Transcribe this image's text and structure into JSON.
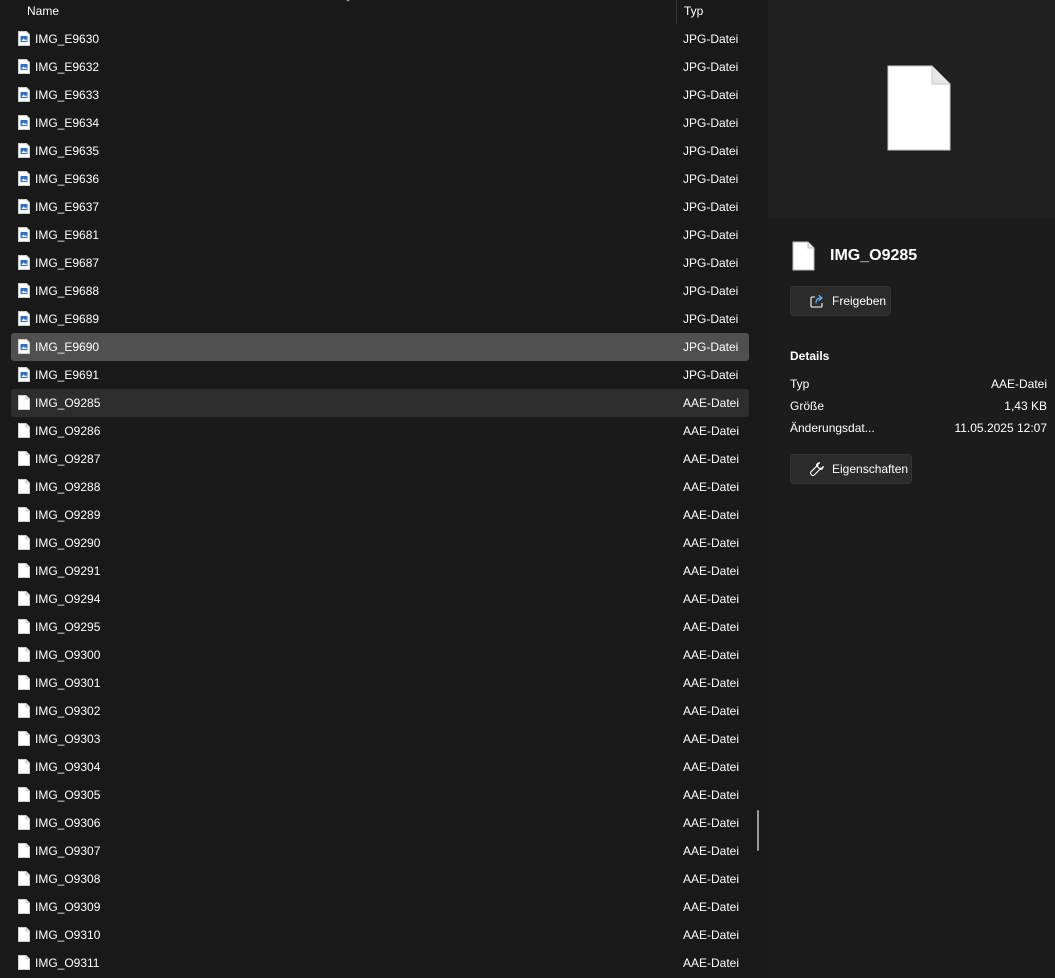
{
  "list": {
    "columns": {
      "name": "Name",
      "type": "Typ"
    },
    "rows": [
      {
        "name": "IMG_E9630",
        "type": "JPG-Datei",
        "icon": "jpg-file-icon",
        "state": ""
      },
      {
        "name": "IMG_E9632",
        "type": "JPG-Datei",
        "icon": "jpg-file-icon",
        "state": ""
      },
      {
        "name": "IMG_E9633",
        "type": "JPG-Datei",
        "icon": "jpg-file-icon",
        "state": ""
      },
      {
        "name": "IMG_E9634",
        "type": "JPG-Datei",
        "icon": "jpg-file-icon",
        "state": ""
      },
      {
        "name": "IMG_E9635",
        "type": "JPG-Datei",
        "icon": "jpg-file-icon",
        "state": ""
      },
      {
        "name": "IMG_E9636",
        "type": "JPG-Datei",
        "icon": "jpg-file-icon",
        "state": ""
      },
      {
        "name": "IMG_E9637",
        "type": "JPG-Datei",
        "icon": "jpg-file-icon",
        "state": ""
      },
      {
        "name": "IMG_E9681",
        "type": "JPG-Datei",
        "icon": "jpg-file-icon",
        "state": ""
      },
      {
        "name": "IMG_E9687",
        "type": "JPG-Datei",
        "icon": "jpg-file-icon",
        "state": ""
      },
      {
        "name": "IMG_E9688",
        "type": "JPG-Datei",
        "icon": "jpg-file-icon",
        "state": ""
      },
      {
        "name": "IMG_E9689",
        "type": "JPG-Datei",
        "icon": "jpg-file-icon",
        "state": ""
      },
      {
        "name": "IMG_E9690",
        "type": "JPG-Datei",
        "icon": "jpg-file-icon",
        "state": "selected"
      },
      {
        "name": "IMG_E9691",
        "type": "JPG-Datei",
        "icon": "jpg-file-icon",
        "state": ""
      },
      {
        "name": "IMG_O9285",
        "type": "AAE-Datei",
        "icon": "blank-file-icon",
        "state": "focused"
      },
      {
        "name": "IMG_O9286",
        "type": "AAE-Datei",
        "icon": "blank-file-icon",
        "state": ""
      },
      {
        "name": "IMG_O9287",
        "type": "AAE-Datei",
        "icon": "blank-file-icon",
        "state": ""
      },
      {
        "name": "IMG_O9288",
        "type": "AAE-Datei",
        "icon": "blank-file-icon",
        "state": ""
      },
      {
        "name": "IMG_O9289",
        "type": "AAE-Datei",
        "icon": "blank-file-icon",
        "state": ""
      },
      {
        "name": "IMG_O9290",
        "type": "AAE-Datei",
        "icon": "blank-file-icon",
        "state": ""
      },
      {
        "name": "IMG_O9291",
        "type": "AAE-Datei",
        "icon": "blank-file-icon",
        "state": ""
      },
      {
        "name": "IMG_O9294",
        "type": "AAE-Datei",
        "icon": "blank-file-icon",
        "state": ""
      },
      {
        "name": "IMG_O9295",
        "type": "AAE-Datei",
        "icon": "blank-file-icon",
        "state": ""
      },
      {
        "name": "IMG_O9300",
        "type": "AAE-Datei",
        "icon": "blank-file-icon",
        "state": ""
      },
      {
        "name": "IMG_O9301",
        "type": "AAE-Datei",
        "icon": "blank-file-icon",
        "state": ""
      },
      {
        "name": "IMG_O9302",
        "type": "AAE-Datei",
        "icon": "blank-file-icon",
        "state": ""
      },
      {
        "name": "IMG_O9303",
        "type": "AAE-Datei",
        "icon": "blank-file-icon",
        "state": ""
      },
      {
        "name": "IMG_O9304",
        "type": "AAE-Datei",
        "icon": "blank-file-icon",
        "state": ""
      },
      {
        "name": "IMG_O9305",
        "type": "AAE-Datei",
        "icon": "blank-file-icon",
        "state": ""
      },
      {
        "name": "IMG_O9306",
        "type": "AAE-Datei",
        "icon": "blank-file-icon",
        "state": ""
      },
      {
        "name": "IMG_O9307",
        "type": "AAE-Datei",
        "icon": "blank-file-icon",
        "state": ""
      },
      {
        "name": "IMG_O9308",
        "type": "AAE-Datei",
        "icon": "blank-file-icon",
        "state": ""
      },
      {
        "name": "IMG_O9309",
        "type": "AAE-Datei",
        "icon": "blank-file-icon",
        "state": ""
      },
      {
        "name": "IMG_O9310",
        "type": "AAE-Datei",
        "icon": "blank-file-icon",
        "state": ""
      },
      {
        "name": "IMG_O9311",
        "type": "AAE-Datei",
        "icon": "blank-file-icon",
        "state": ""
      }
    ]
  },
  "details": {
    "file_name": "IMG_O9285",
    "share_label": "Freigeben",
    "heading": "Details",
    "props": [
      {
        "label": "Typ",
        "value": "AAE-Datei"
      },
      {
        "label": "Größe",
        "value": "1,43 KB"
      },
      {
        "label": "Änderungsdat...",
        "value": "11.05.2025 12:07"
      }
    ],
    "properties_label": "Eigenschaften"
  },
  "colors": {
    "background": "#191919",
    "selected_row": "#505050",
    "focused_row": "#2d2d2d",
    "accent_blue": "#2f6fc4",
    "details_bg": "#1c1c1c",
    "preview_bg": "#202020"
  }
}
